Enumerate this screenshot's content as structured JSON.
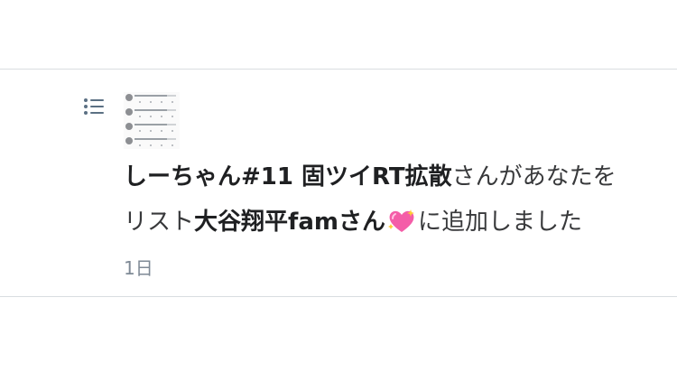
{
  "notification": {
    "icon": "list-icon",
    "message": {
      "line1_bold": "しーちゃん#11 固ツイRT拡散",
      "line1_rest": "さんがあなたを",
      "line2_prefix": "リスト",
      "line2_bold": "大谷翔平famさん",
      "line2_emoji": "sparkling-heart-icon",
      "line2_suffix": "に追加しました"
    },
    "time": "1日"
  },
  "colors": {
    "icon": "#5b7083",
    "text": "#38393b",
    "bold_text": "#1f2022",
    "time": "#7f8a96",
    "divider": "#d9dde1",
    "heart": "#f45da8"
  }
}
